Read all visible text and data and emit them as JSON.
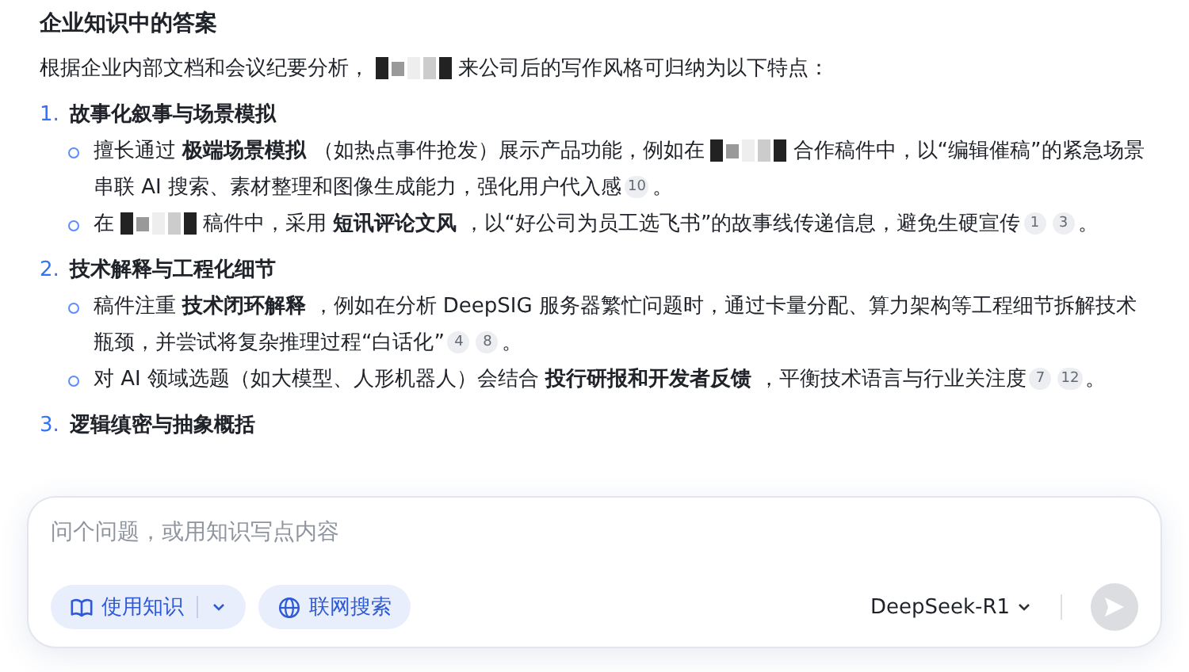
{
  "answer": {
    "heading": "企业知识中的答案",
    "intro": [
      {
        "kind": "text",
        "text": "根据企业内部文档和会议纪要分析，"
      },
      {
        "kind": "redacted"
      },
      {
        "kind": "text",
        "text": "来公司后的写作风格可归纳为以下特点："
      }
    ],
    "sections": [
      {
        "number": "1.",
        "title": "故事化叙事与场景模拟",
        "points": [
          [
            {
              "kind": "text",
              "text": "擅长通过 **极端场景模拟** （如热点事件抢发）展示产品功能，例如在"
            },
            {
              "kind": "redacted"
            },
            {
              "kind": "text",
              "text": "合作稿件中，以“编辑催稿”的紧急场景串联 AI 搜索、素材整理和图像生成能力，强化用户代入感"
            },
            {
              "kind": "cite",
              "text": "10"
            },
            {
              "kind": "text",
              "text": "。"
            }
          ],
          [
            {
              "kind": "text",
              "text": "在"
            },
            {
              "kind": "redacted"
            },
            {
              "kind": "text",
              "text": "稿件中，采用 **短讯评论文风** ，以“好公司为员工选飞书”的故事线传递信息，避免生硬宣传"
            },
            {
              "kind": "cite",
              "text": "1"
            },
            {
              "kind": "cite",
              "text": "3"
            },
            {
              "kind": "text",
              "text": "。"
            }
          ]
        ]
      },
      {
        "number": "2.",
        "title": "技术解释与工程化细节",
        "points": [
          [
            {
              "kind": "text",
              "text": "稿件注重 **技术闭环解释** ，例如在分析 DeepSIG 服务器繁忙问题时，通过卡量分配、算力架构等工程细节拆解技术瓶颈，并尝试将复杂推理过程“白话化”"
            },
            {
              "kind": "cite",
              "text": "4"
            },
            {
              "kind": "cite",
              "text": "8"
            },
            {
              "kind": "text",
              "text": "。"
            }
          ],
          [
            {
              "kind": "text",
              "text": "对 AI 领域选题（如大模型、人形机器人）会结合 **投行研报和开发者反馈** ，平衡技术语言与行业关注度"
            },
            {
              "kind": "cite",
              "text": "7"
            },
            {
              "kind": "cite",
              "text": "12"
            },
            {
              "kind": "text",
              "text": "。"
            }
          ]
        ]
      },
      {
        "number": "3.",
        "title": "逻辑缜密与抽象概括"
      }
    ]
  },
  "composer": {
    "placeholder": "问个问题，或用知识写点内容",
    "knowledge_button": "使用知识",
    "web_search_button": "联网搜索",
    "model": "DeepSeek-R1",
    "send_disabled": true
  }
}
